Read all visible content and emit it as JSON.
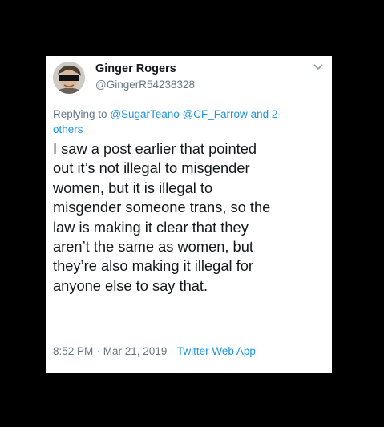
{
  "tweet": {
    "author": {
      "display_name": "Ginger Rogers",
      "handle": "@GingerR54238328"
    },
    "reply": {
      "prefix": "Replying to",
      "mention_1": "@SugarTeano",
      "mention_2": "@CF_Farrow",
      "and_text": "and 2",
      "others": "others"
    },
    "text_lines": [
      "I saw a post earlier that pointed",
      "out it’s not illegal to misgender",
      "women, but it is illegal to",
      "misgender someone trans, so the",
      "law is making it clear that they",
      "aren’t the same as women, but",
      "they’re also making it illegal for",
      "anyone else to say that."
    ],
    "time": "8:52 PM",
    "date": "Mar 21, 2019",
    "source": "Twitter Web App",
    "separator": "·"
  },
  "icons": {
    "avatar": "profile-photo",
    "menu": "chevron-down-icon"
  },
  "colors": {
    "background": "#000000",
    "card": "#ffffff",
    "text": "#14171a",
    "secondary": "#657786",
    "link": "#1b95e0"
  }
}
